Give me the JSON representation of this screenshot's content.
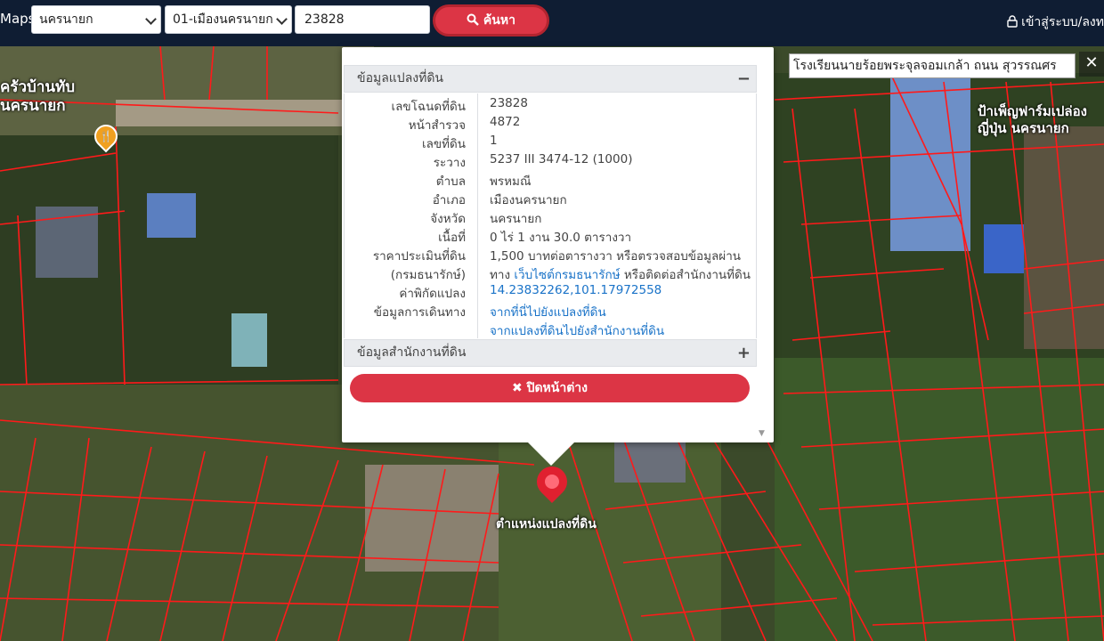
{
  "header": {
    "brand": "Maps",
    "province": "นครนายก",
    "district": "01-เมืองนครนายก",
    "parcel_value": "23828",
    "search_label": "ค้นหา",
    "login_label": "เข้าสู่ระบบ/ลงท"
  },
  "map": {
    "labels": {
      "restaurant": "ครัวบ้านทับ\nนครนายก",
      "farm": "ป้าเพ็ญฟาร์มเปล่อง\nญี่ปุ่น นครนายก"
    },
    "search_result": "โรงเรียนนายร้อยพระจุลจอมเกล้า ถนน สุวรรณศร",
    "marker_label": "ตำแหน่งแปลงที่ดิน"
  },
  "popup": {
    "section1_title": "ข้อมูลแปลงที่ดิน",
    "section1_toggle": "−",
    "rows": [
      {
        "label": "เลขโฉนดที่ดิน",
        "value": "23828"
      },
      {
        "label": "หน้าสำรวจ",
        "value": "4872"
      },
      {
        "label": "เลขที่ดิน",
        "value": "1"
      },
      {
        "label": "ระวาง",
        "value": "5237 III 3474-12 (1000)"
      },
      {
        "label": "ตำบล",
        "value": "พรหมณี"
      },
      {
        "label": "อำเภอ",
        "value": "เมืองนครนายก"
      },
      {
        "label": "จังหวัด",
        "value": "นครนายก"
      },
      {
        "label": "เนื้อที่",
        "value": "0 ไร่ 1 งาน 30.0 ตารางวา"
      },
      {
        "label": "ราคาประเมินที่ดิน",
        "value": "1,500 บาทต่อตารางวา หรือตรวจสอบข้อมูลผ่าน"
      },
      {
        "label": "(กรมธนารักษ์)",
        "value_prefix": "ทาง ",
        "value_link": "เว็บไซต์กรมธนารักษ์",
        "value_suffix": " หรือติดต่อสำนักงานที่ดิน"
      },
      {
        "label": "ค่าพิกัดแปลง",
        "value": "14.23832262,101.17972558"
      },
      {
        "label": "ข้อมูลการเดินทาง",
        "value": "จากที่นี่ไปยังแปลงที่ดิน"
      },
      {
        "label": "",
        "value": "จากแปลงที่ดินไปยังสำนักงานที่ดิน"
      }
    ],
    "section2_title": "ข้อมูลสำนักงานที่ดิน",
    "section2_toggle": "+",
    "close_label": "ปิดหน้าต่าง"
  }
}
